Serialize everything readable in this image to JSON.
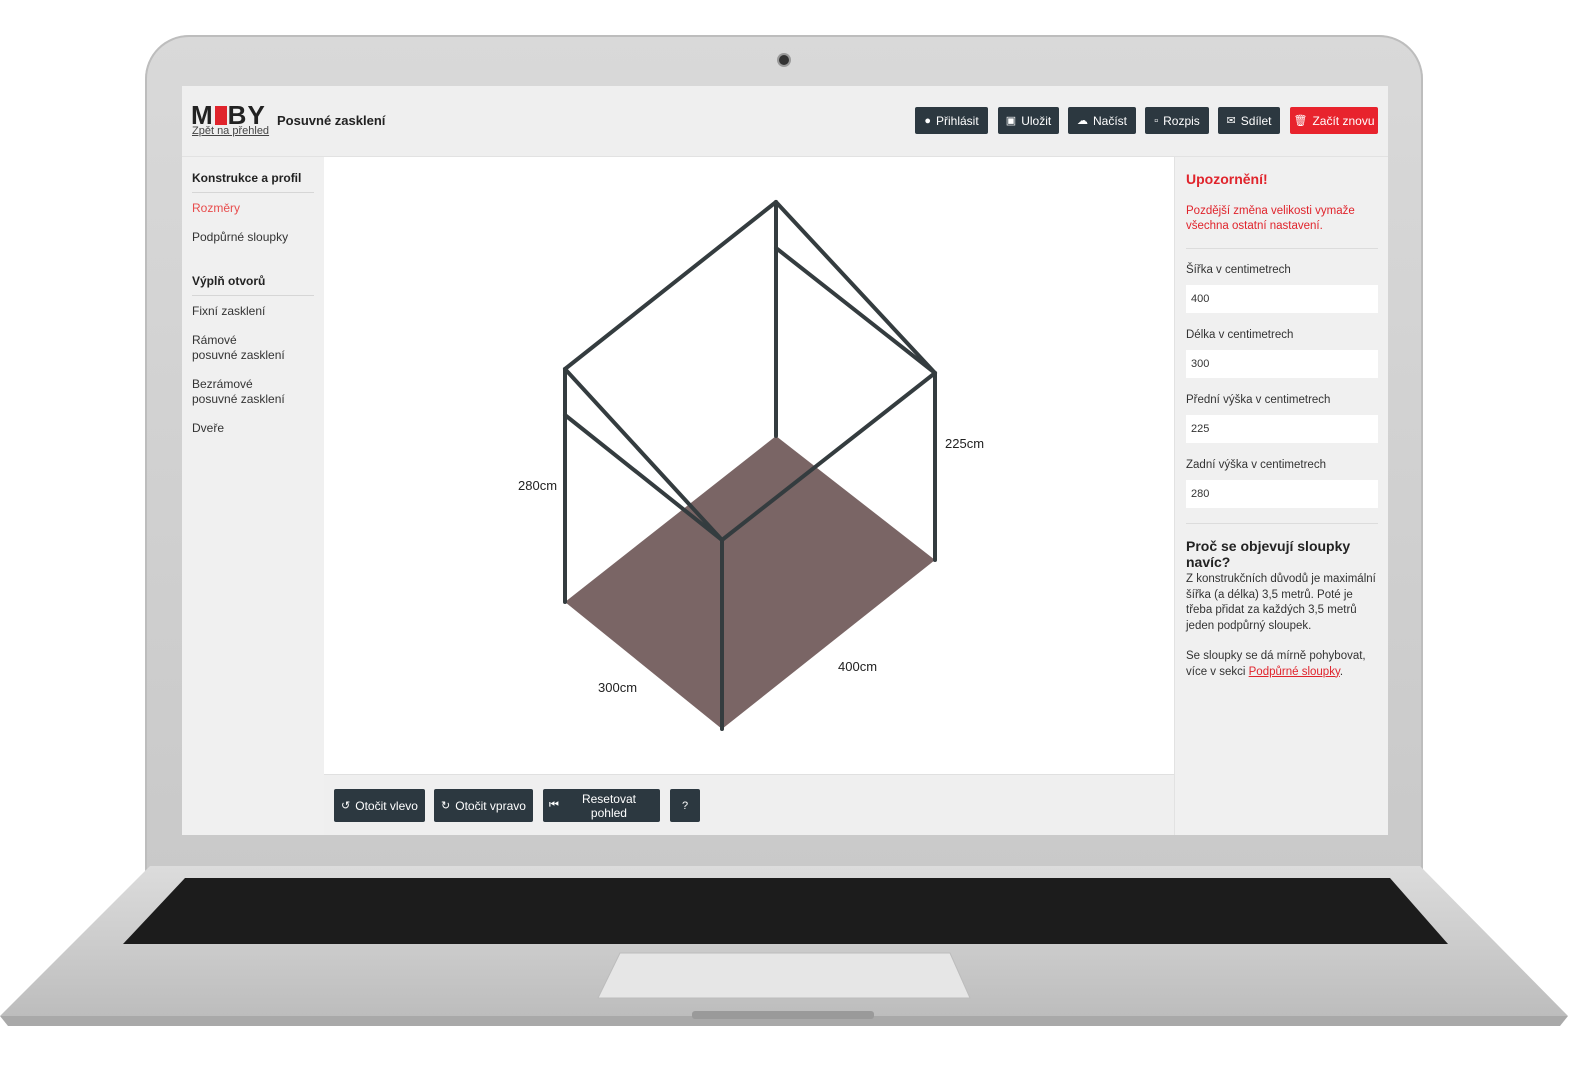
{
  "header": {
    "logo_left": "M",
    "logo_right": "BY",
    "back_link": "Zpět na přehled",
    "title": "Posuvné zasklení",
    "buttons": [
      {
        "label": "Přihlásit",
        "icon": "user-icon"
      },
      {
        "label": "Uložit",
        "icon": "save-icon"
      },
      {
        "label": "Načíst",
        "icon": "cloud-upload-icon"
      },
      {
        "label": "Rozpis",
        "icon": "clipboard-icon"
      },
      {
        "label": "Sdílet",
        "icon": "envelope-icon"
      },
      {
        "label": "Začít znovu",
        "icon": "trash-icon"
      }
    ]
  },
  "sidebar": {
    "section1": {
      "heading": "Konstrukce a profil",
      "items": [
        "Rozměry",
        "Podpůrné sloupky"
      ]
    },
    "section2": {
      "heading": "Výplň otvorů",
      "items": [
        {
          "line1": "Fixní zasklení",
          "line2": ""
        },
        {
          "line1": "Rámové",
          "line2": "posuvné zasklení"
        },
        {
          "line1": "Bezrámové",
          "line2": "posuvné zasklení"
        },
        {
          "line1": "Dveře",
          "line2": ""
        }
      ]
    },
    "active_item": "Rozměry"
  },
  "viewer": {
    "labels": {
      "back_height": "280cm",
      "front_height": "225cm",
      "length": "300cm",
      "width": "400cm"
    },
    "colors": {
      "floor": "#7a6565",
      "frame": "#343c3f"
    },
    "toolbar": [
      {
        "label": "Otočit vlevo",
        "icon": "rotate-left-icon"
      },
      {
        "label": "Otočit vpravo",
        "icon": "rotate-right-icon"
      },
      {
        "label": "Resetovat pohled",
        "icon": "reset-view-icon"
      },
      {
        "label": "",
        "icon": "help-icon"
      }
    ]
  },
  "panel": {
    "warning_title": "Upozornění!",
    "warning_text": "Pozdější změna velikosti vymaže všechna ostatní nastavení.",
    "fields": [
      {
        "label": "Šířka v centimetrech",
        "value": "400"
      },
      {
        "label": "Délka v centimetrech",
        "value": "300"
      },
      {
        "label": "Přední výška v centimetrech",
        "value": "225"
      },
      {
        "label": "Zadní výška v centimetrech",
        "value": "280"
      }
    ],
    "why_title": "Proč se objevují sloupky navíc?",
    "why_text1": "Z konstrukčních důvodů je maximální šířka (a délka) 3,5 metrů. Poté je třeba přidat za každých 3,5 metrů jeden podpůrný sloupek.",
    "why_text2_before": "Se sloupky se dá mírně pohybovat, více v sekci ",
    "why_text2_link": "Podpůrné sloupky",
    "why_text2_after": "."
  },
  "theme": {
    "accent": "#e0242c",
    "dark_button": "#2c3840"
  }
}
